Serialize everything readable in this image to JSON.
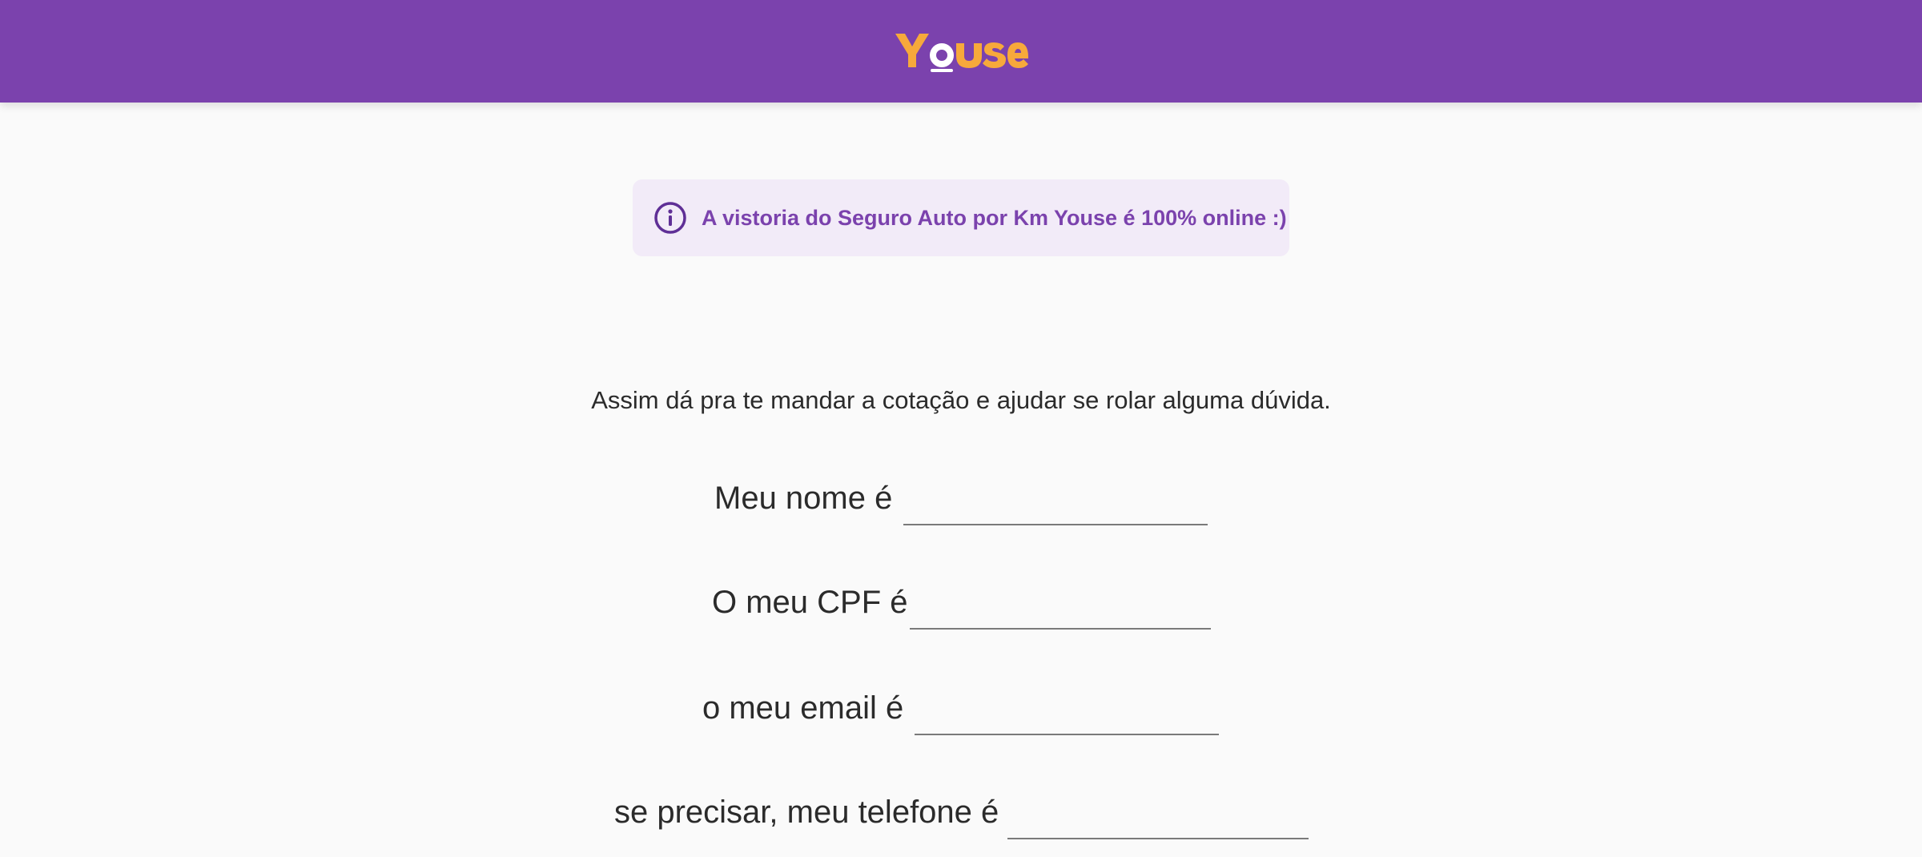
{
  "header": {
    "logo_text": "YOUSE",
    "background_color": "#7b42ad",
    "logo_color": "#f7a93b",
    "logo_accent_color": "#ffffff"
  },
  "info_banner": {
    "icon": "info-icon",
    "text": "A vistoria do Seguro Auto por Km Youse é 100% online :)",
    "background_color": "#f2ebf8",
    "text_color": "#7b42ad"
  },
  "form": {
    "intro": "Assim dá pra te mandar a cotação e ajudar se rolar alguma dúvida.",
    "fields": [
      {
        "label": "Meu nome é",
        "value": ""
      },
      {
        "label": "O meu CPF é",
        "value": ""
      },
      {
        "label": "o meu email é",
        "value": ""
      },
      {
        "label": "se precisar, meu telefone é",
        "value": ""
      }
    ]
  }
}
